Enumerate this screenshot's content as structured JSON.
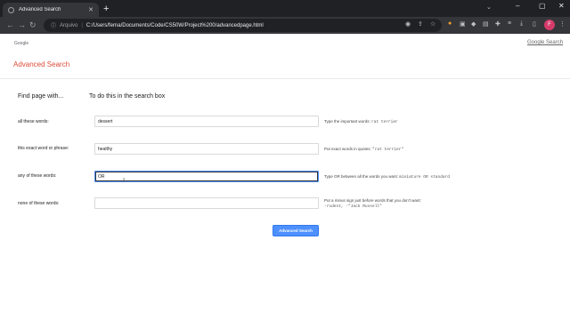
{
  "browser": {
    "tab_title": "Advanced Search",
    "new_tab": "+",
    "address_info": "ⓘ",
    "address_scheme": "Arquivo",
    "address_url": "C:/Users/ferna/Documents/Code/CS50W/Project%200/advancedpage.html",
    "profile_initial": "F",
    "window_controls": [
      "–",
      "▢",
      "✕"
    ]
  },
  "page": {
    "logo_text": "Google",
    "top_link": "Google Search",
    "title": "Advanced Search",
    "find_with": "Find page with...",
    "to_do": "To do this in the search box",
    "rows": [
      {
        "label": "all these words:",
        "value": "dessert",
        "hint": "Type the important words: ",
        "hint_code": "rat terrier"
      },
      {
        "label": "this exact word or phrase:",
        "value": "healthy",
        "hint": "Put exact words in quotes: ",
        "hint_code": "\"rat terrier\""
      },
      {
        "label": "any of these words:",
        "value": "OR",
        "hint": "Type OR between all the words you want: ",
        "hint_code": "miniature OR standard"
      },
      {
        "label": "none of these words:",
        "value": "",
        "hint": "Put a minus sign just before words that you don't want:",
        "hint_code": "-rodent, -\"Jack Russell\""
      }
    ],
    "submit_label": "Advanced Search"
  }
}
